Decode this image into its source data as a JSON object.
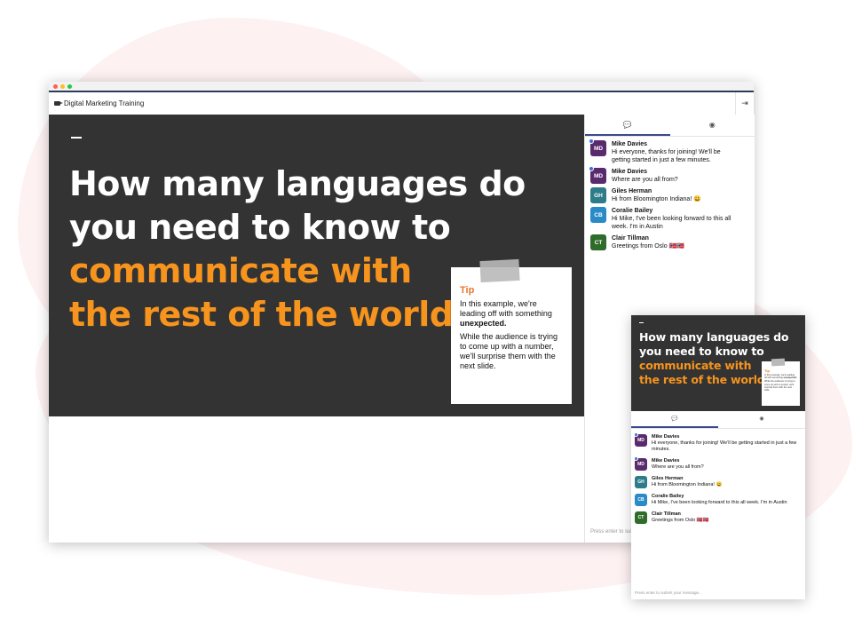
{
  "app": {
    "title": "Digital Marketing Training"
  },
  "slide": {
    "line1": "How many languages do",
    "line2": "you need to know to",
    "line3": "communicate with",
    "line4": "the rest of the world?"
  },
  "tip": {
    "title": "Tip",
    "p1_pre": "In this example, we're leading off with something ",
    "p1_bold": "unexpected.",
    "p2": "While the audience is trying to come up with a number, we'll surprise them with the next slide."
  },
  "chat": {
    "messages": [
      {
        "initials": "MD",
        "name": "Mike Davies",
        "text": "Hi everyone, thanks for joining! We'll be getting started in just a few minutes.",
        "color": "#5a2a6e"
      },
      {
        "initials": "MD",
        "name": "Mike Davies",
        "text": "Where are you all from?",
        "color": "#5a2a6e"
      },
      {
        "initials": "GH",
        "name": "Giles Herman",
        "text": "Hi from Bloomington Indiana! 😀",
        "color": "#2e7c8a"
      },
      {
        "initials": "CB",
        "name": "Coralie Bailey",
        "text": "Hi Mike, I've been looking forward to this all week. I'm in Austin",
        "color": "#2a8ac8"
      },
      {
        "initials": "CT",
        "name": "Clair Tillman",
        "text": "Greetings from Oslo 🇳🇴🇳🇴",
        "color": "#2f6b2a"
      }
    ],
    "input_placeholder": "Press enter to submit your message..."
  },
  "icons": {
    "chat_tab": "chat-bubble-icon",
    "people_tab": "person-icon",
    "exit": "exit-icon",
    "camera": "video-camera-icon"
  },
  "colors": {
    "accent": "#f7941e",
    "slide_bg": "#333333",
    "tab_active": "#3b4a8c",
    "tip_title": "#e8772e"
  }
}
